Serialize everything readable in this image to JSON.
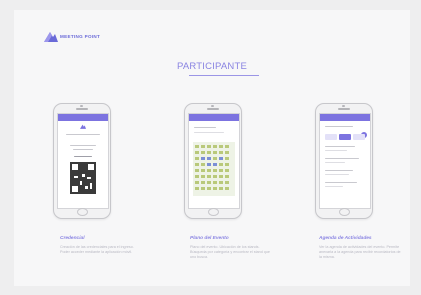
{
  "brand": {
    "name": "MEETING POINT",
    "color": "#6a6ad8",
    "icon": "mountain-logo-icon"
  },
  "section_title": "PARTICIPANTE",
  "accent_color": "#8a84e2",
  "features": [
    {
      "title": "Credencial",
      "description": "Creación de las credenciales para el ingreso. Poder acceder mediante la aplicación móvil."
    },
    {
      "title": "Plano del Evento",
      "description": "Plano del evento. Ubicación de los stands. Búsqueda por categoría y encontrar el stand que uno busca."
    },
    {
      "title": "Agenda de Actividades",
      "description": "Ver la agenda de actividades del evento. Permite anexarla a la agenda para recibir recordatorios de la misma."
    }
  ]
}
